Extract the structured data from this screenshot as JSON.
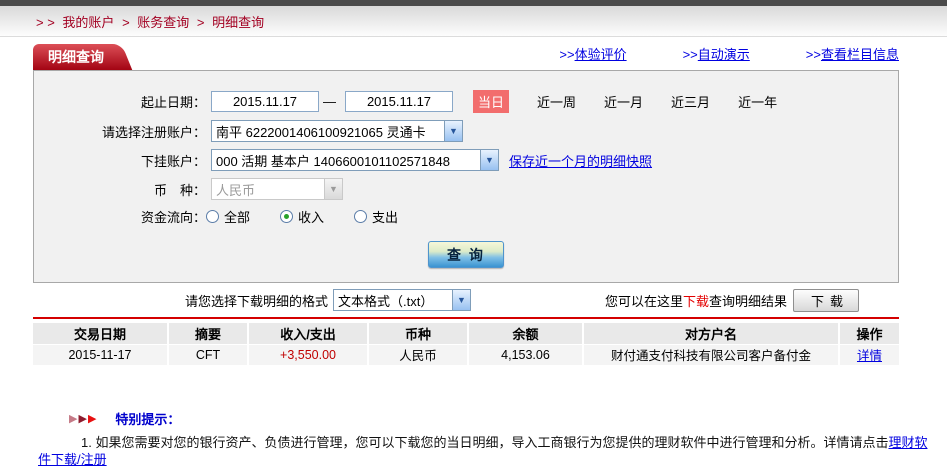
{
  "colors": {
    "brand_red": "#a30413",
    "breadcrumb_red": "#a30022",
    "link_blue": "#0000e0",
    "highlight_badge_red": "#f26d6d",
    "divider_red": "#d40000",
    "amount_red": "#c00000",
    "notice_title_blue": "#0000cc"
  },
  "breadcrumb": {
    "prefix": "> >",
    "sep": ">",
    "items": [
      "我的账户",
      "账务查询",
      "明细查询"
    ]
  },
  "tab_title": "明细查询",
  "header_links": [
    {
      "prefix": ">>",
      "label": "体验评价"
    },
    {
      "prefix": ">>",
      "label": "自动演示"
    },
    {
      "prefix": ">>",
      "label": "查看栏目信息"
    }
  ],
  "form": {
    "date_row": {
      "label": "起止日期：",
      "from": "2015.11.17",
      "dash": "—",
      "to": "2015.11.17",
      "ranges": [
        {
          "label": "当日",
          "active": true
        },
        {
          "label": "近一周",
          "active": false
        },
        {
          "label": "近一月",
          "active": false
        },
        {
          "label": "近三月",
          "active": false
        },
        {
          "label": "近一年",
          "active": false
        }
      ]
    },
    "account_row": {
      "label": "请选择注册账户：",
      "value": "南平 6222001406100921065 灵通卡"
    },
    "sub_account_row": {
      "label": "下挂账户：",
      "value": "000 活期 基本户 1406600101102571848",
      "snapshot_link": "保存近一个月的明细快照"
    },
    "currency_row": {
      "label": "币　种：",
      "value": "人民币"
    },
    "flow_row": {
      "label": "资金流向：",
      "options": [
        {
          "label": "全部",
          "checked": false
        },
        {
          "label": "收入",
          "checked": true
        },
        {
          "label": "支出",
          "checked": false
        }
      ]
    },
    "query_button": "查 询"
  },
  "download_bar": {
    "format_label": "请您选择下载明细的格式",
    "format_value": "文本格式（.txt）",
    "hint_pre": "您可以在这里",
    "hint_red": "下载",
    "hint_post": "查询明细结果",
    "download_button": "下载"
  },
  "table": {
    "headers": [
      "交易日期",
      "摘要",
      "收入/支出",
      "币种",
      "余额",
      "对方户名",
      "操作"
    ],
    "rows": [
      {
        "date": "2015-11-17",
        "summary": "CFT",
        "amount": "+3,550.00",
        "currency": "人民币",
        "balance": "4,153.06",
        "counterparty": "财付通支付科技有限公司客户备付金",
        "action": "详情"
      }
    ]
  },
  "notice": {
    "title": "特别提示：",
    "line1_text": "1. 如果您需要对您的银行资产、负债进行管理，您可以下载您的当日明细，导入工商银行为您提供的理财软件中进行管理和分析。详情请点击",
    "line1_link": "理财软件下载/注册"
  }
}
